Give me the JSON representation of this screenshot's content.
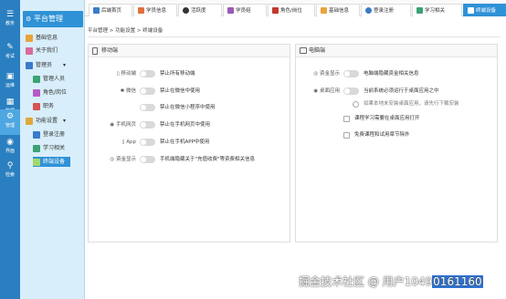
{
  "rail": {
    "items": [
      {
        "label": "教务",
        "icon": "book-icon"
      },
      {
        "label": "考试",
        "icon": "exam-icon"
      },
      {
        "label": "运维",
        "icon": "monitor-icon"
      },
      {
        "label": "数据",
        "icon": "chart-icon"
      },
      {
        "label": "管理",
        "icon": "gear-icon"
      },
      {
        "label": "界面",
        "icon": "palette-icon"
      },
      {
        "label": "检索",
        "icon": "search-icon"
      }
    ]
  },
  "sidebar": {
    "title": "平台管理",
    "items": [
      {
        "label": "基础信息"
      },
      {
        "label": "关于我们"
      },
      {
        "label": "管理员"
      },
      {
        "label": "管理人员"
      },
      {
        "label": "角色/岗位"
      },
      {
        "label": "职务"
      },
      {
        "label": "功能设置"
      },
      {
        "label": "登录注册"
      },
      {
        "label": "学习相关"
      },
      {
        "label": "终端设备"
      }
    ]
  },
  "tabs": [
    {
      "label": "后端首页"
    },
    {
      "label": "学员信息"
    },
    {
      "label": "活跃度"
    },
    {
      "label": "学员组"
    },
    {
      "label": "角色/岗位"
    },
    {
      "label": "基础信息"
    },
    {
      "label": "登录注册"
    },
    {
      "label": "学习相关"
    },
    {
      "label": "终端设备"
    }
  ],
  "breadcrumb": "平台管理 > 功能设置 > 终端设备",
  "mobile": {
    "title": "移动端",
    "rows": [
      {
        "label": "移动端",
        "text": "禁止所有移动端"
      },
      {
        "label": "微信",
        "text": "禁止在微信中使用"
      },
      {
        "label": "",
        "text": "禁止在微信小程序中使用"
      },
      {
        "label": "手机网页",
        "text": "禁止在手机网页中使用"
      },
      {
        "label": "App",
        "text": "禁止在手机APP中使用"
      },
      {
        "label": "资金显示",
        "text": "手机端隐藏关于\"充值收费\"等资费相关信息"
      }
    ]
  },
  "pc": {
    "title": "电脑端",
    "rows": [
      {
        "label": "资金显示",
        "text": "电脑端隐藏资金相关信息"
      },
      {
        "label": "桌面应用",
        "text": "当前系统必须运行于桌面应用之中"
      }
    ],
    "options": [
      {
        "text": "如果本地未安装桌面应用，请先行下载安装",
        "type": "radio"
      },
      {
        "text": "课程学习需要在桌面应用打开",
        "type": "check"
      },
      {
        "text": "免费课程和试用章节除外",
        "type": "check"
      }
    ]
  },
  "watermark": {
    "text": "掘金技术社区 @ 用户1049",
    "highlight": "0161160"
  },
  "colors": {
    "rail": "#2a7fc0",
    "accent": "#2f92d6",
    "sidebar_bg": "#d8eefa"
  }
}
